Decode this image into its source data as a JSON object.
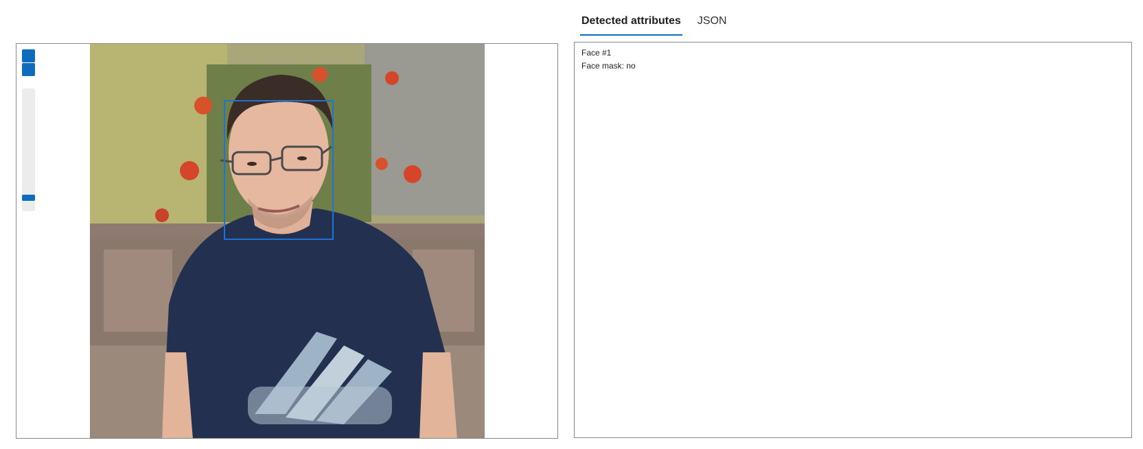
{
  "tabs": [
    {
      "label": "Detected attributes",
      "active": true
    },
    {
      "label": "JSON",
      "active": false
    }
  ],
  "viewer": {
    "zoom_level": 0.05,
    "accent_color": "#0f6cbd",
    "face_box_color": "#1e74d6"
  },
  "results": {
    "lines": [
      "Face #1",
      "Face mask: no"
    ]
  }
}
